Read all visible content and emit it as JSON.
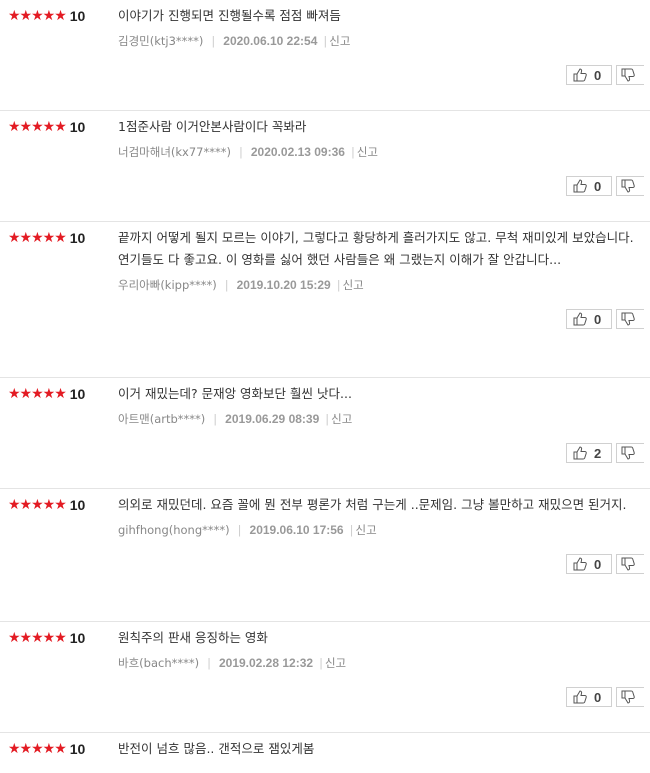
{
  "rating": {
    "stars": "★★★★★"
  },
  "reviews": [
    {
      "score": "10",
      "text": "이야기가 진행되면 진행될수록 점점 빠져듬",
      "author": "김경민(ktj3****)",
      "date": "2020.06.10 22:54",
      "report": "신고",
      "up": "0"
    },
    {
      "score": "10",
      "text": "1점준사람 이거안본사람이다 꼭봐라",
      "author": "너검마해녀(kx77****)",
      "date": "2020.02.13 09:36",
      "report": "신고",
      "up": "0"
    },
    {
      "score": "10",
      "text": "끝까지 어떻게 될지 모르는 이야기, 그렇다고 황당하게 흘러가지도 않고. 무척 재미있게 보았습니다. 연기들도 다 좋고요. 이 영화를 싫어 했던 사람들은 왜 그랬는지 이해가 잘 안갑니다...",
      "author": "우리아빠(kipp****)",
      "date": "2019.10.20 15:29",
      "report": "신고",
      "up": "0"
    },
    {
      "score": "10",
      "text": "이거 재밌는데? 문재앙 영화보단 훨씬 낫다...",
      "author": "아트맨(artb****)",
      "date": "2019.06.29 08:39",
      "report": "신고",
      "up": "2"
    },
    {
      "score": "10",
      "text": "의외로 재밌던데. 요즘 꼴에 뭔 전부 평론가 처럼 구는게 ..문제임. 그냥 볼만하고 재밌으면 된거지.",
      "author": "gihfhong(hong****)",
      "date": "2019.06.10 17:56",
      "report": "신고",
      "up": "0"
    },
    {
      "score": "10",
      "text": "원칙주의 판새 응징하는 영화",
      "author": "바흐(bach****)",
      "date": "2019.02.28 12:32",
      "report": "신고",
      "up": "0"
    },
    {
      "score": "10",
      "text": "반전이 넘흐 많음.. 갠적으로 잼있게봄"
    }
  ]
}
